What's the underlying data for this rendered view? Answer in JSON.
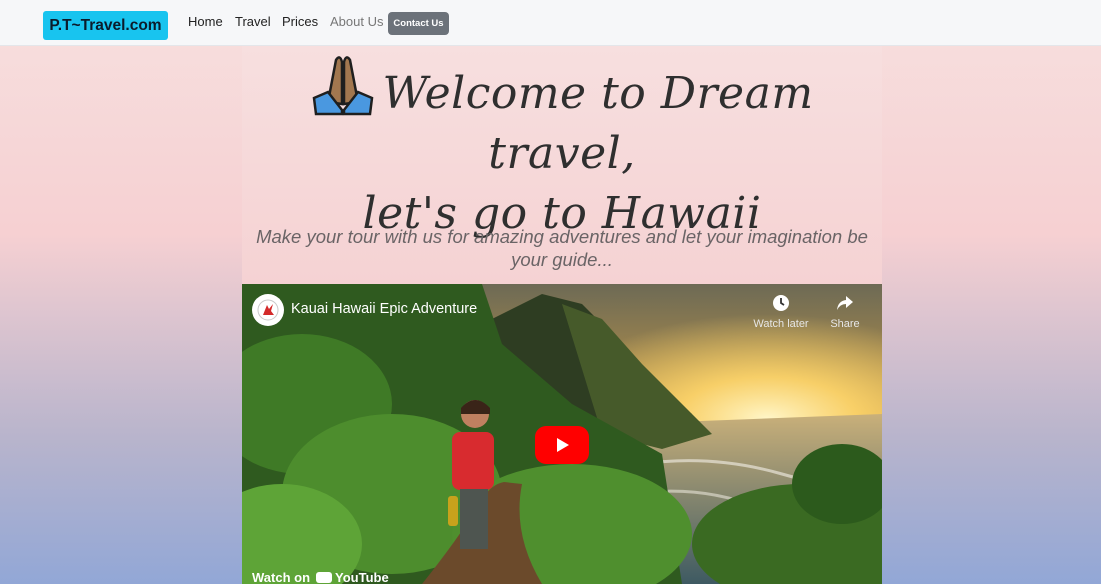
{
  "navbar": {
    "brand": "P.T~Travel.com",
    "links": [
      "Home",
      "Travel",
      "Prices",
      "About Us"
    ],
    "contact_label": "Contact Us"
  },
  "hero": {
    "title_line1": "Welcome to Dream travel,",
    "title_line2": "let's go to Hawaii",
    "icon": "folded-hands-icon",
    "subtitle": "Make your tour with us for amazing adventures and let your imagination be your guide..."
  },
  "video": {
    "title": "Kauai Hawaii Epic Adventure",
    "watch_later": "Watch later",
    "share": "Share",
    "watch_on": "Watch on",
    "platform": "YouTube"
  },
  "colors": {
    "brand_bg": "#18c4ef",
    "contact_bg": "#6c727a",
    "play_red": "#ff0000"
  }
}
